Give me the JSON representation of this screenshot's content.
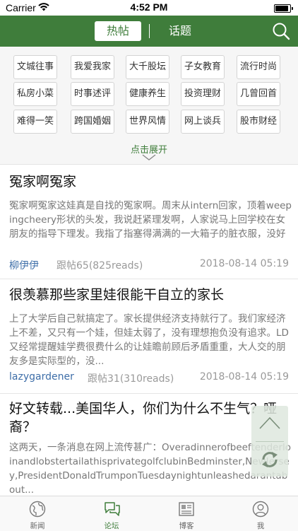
{
  "status": {
    "carrier": "Carrier",
    "time": "4:52 PM"
  },
  "header": {
    "tab_hot": "热帖",
    "tab_topic": "话题"
  },
  "categories": [
    "文城往事",
    "我爱我家",
    "大千股坛",
    "子女教育",
    "流行时尚",
    "私房小菜",
    "时事述评",
    "健康养生",
    "投资理财",
    "几曾回首",
    "难得一笑",
    "跨国婚姻",
    "世界风情",
    "网上谈兵",
    "股市财经"
  ],
  "expand_label": "点击展开",
  "posts": [
    {
      "title": "冤家啊冤家",
      "excerpt": "冤家啊冤家这娃真是自找的冤家啊。周末从intern回家，顶着weepingcheery形状的头发，我说赶紧理发啊，人家说马上回学校在女朋友的指导下理发。我指了指塞得满满的一大箱子的脏衣服，没好气的问，啥时候她tak...",
      "author": "柳伊伊",
      "stats": "跟帖65(825reads)",
      "date": "2018-08-14 05:19"
    },
    {
      "title": "很羡慕那些家里娃很能干自立的家长",
      "excerpt": "上了大学后自己就搞定了。家长提供经济支持就行了。我们家经济上不差，又只有一个娃，但娃太弱了，没有理想抱负没有追求。LD又经常提醒娃学费很费什么的让娃瞻前顾后矛盾重重，大人交的朋友多是实际型的，没...",
      "author": "lazygardener",
      "stats": "跟帖31(310reads)",
      "date": "2018-08-14 05:19"
    },
    {
      "title": "好文转载...美国华人，你们为什么不生气？哑裔？",
      "excerpt": "这两天，一条消息在网上流传甚广：OveradinnerofbeeftenderloinandlobstertailathisprivategolfclubinBedminster,NewJersey,PresidentDonaldTrumponTuesdaynightunleashedarantabout...",
      "author": "",
      "stats": "",
      "date": ""
    }
  ],
  "tabbar": [
    {
      "label": "新闻",
      "icon": "globe-icon"
    },
    {
      "label": "论坛",
      "icon": "chat-bubbles-icon"
    },
    {
      "label": "博客",
      "icon": "newspaper-icon"
    },
    {
      "label": "我",
      "icon": "person-icon"
    }
  ],
  "colors": {
    "brand_green": "#3f7d3b",
    "author_blue": "#3e6ea8"
  }
}
